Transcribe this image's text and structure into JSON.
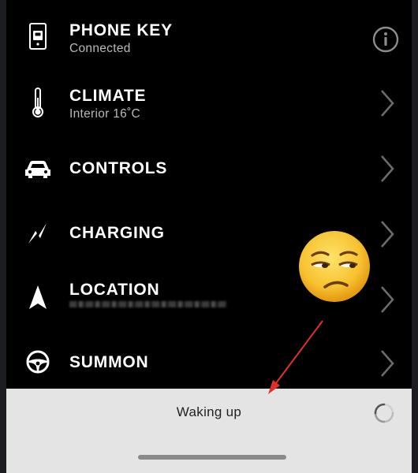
{
  "menu": {
    "phone_key": {
      "title": "PHONE KEY",
      "subtitle": "Connected",
      "icon": "phone-key-icon",
      "action_icon": "info-icon"
    },
    "climate": {
      "title": "CLIMATE",
      "subtitle": "Interior 16˚C",
      "icon": "thermometer-icon",
      "action_icon": "chevron-right-icon"
    },
    "controls": {
      "title": "CONTROLS",
      "icon": "car-icon",
      "action_icon": "chevron-right-icon"
    },
    "charging": {
      "title": "CHARGING",
      "icon": "lightning-icon",
      "action_icon": "chevron-right-icon"
    },
    "location": {
      "title": "LOCATION",
      "icon": "navigation-arrow-icon",
      "action_icon": "chevron-right-icon"
    },
    "summon": {
      "title": "SUMMON",
      "icon": "steering-wheel-icon",
      "action_icon": "chevron-right-icon"
    }
  },
  "status_sheet": {
    "status_text": "Waking up",
    "spinner_icon": "loading-spinner-icon"
  },
  "overlays": {
    "emoji": "unamused-face-emoji",
    "arrow": "red-arrow-annotation"
  },
  "colors": {
    "background": "#000000",
    "sheet": "#e4e4e4",
    "text_primary": "#ffffff",
    "text_secondary": "#b9b9b9",
    "annotation_red": "#e0302a",
    "emoji_yellow": "#f7c230"
  }
}
